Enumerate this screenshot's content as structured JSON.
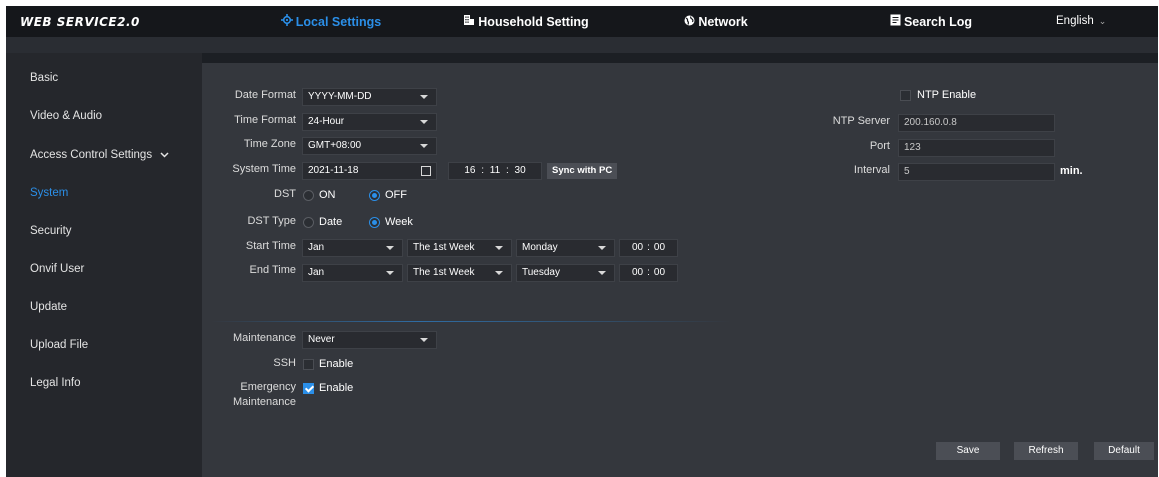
{
  "brand": "WEB SERVICE2.0",
  "nav": [
    {
      "label": "Local Settings",
      "icon": "gear-icon",
      "active": true
    },
    {
      "label": "Household Setting",
      "icon": "building-icon",
      "active": false
    },
    {
      "label": "Network",
      "icon": "globe-icon",
      "active": false
    },
    {
      "label": "Search Log",
      "icon": "document-icon",
      "active": false
    }
  ],
  "language": "English",
  "sidebar": {
    "items": [
      "Basic",
      "Video & Audio",
      "Access Control Settings",
      "System",
      "Security",
      "Onvif User",
      "Update",
      "Upload File",
      "Legal Info"
    ],
    "active": "System"
  },
  "form": {
    "date_format": {
      "label": "Date Format",
      "value": "YYYY-MM-DD"
    },
    "time_format": {
      "label": "Time Format",
      "value": "24-Hour"
    },
    "time_zone": {
      "label": "Time Zone",
      "value": "GMT+08:00"
    },
    "system_time": {
      "label": "System Time",
      "date": "2021-11-18",
      "hour": "16",
      "minute": "11",
      "second": "30",
      "sep": ":",
      "sync_label": "Sync with PC"
    },
    "dst": {
      "label": "DST",
      "on_label": "ON",
      "off_label": "OFF",
      "value": "OFF"
    },
    "dst_type": {
      "label": "DST Type",
      "date_label": "Date",
      "week_label": "Week",
      "value": "Week"
    },
    "start_time": {
      "label": "Start Time",
      "month": "Jan",
      "week": "The 1st Week",
      "day": "Monday",
      "hour": "00",
      "minute": "00"
    },
    "end_time": {
      "label": "End Time",
      "month": "Jan",
      "week": "The 1st Week",
      "day": "Tuesday",
      "hour": "00",
      "minute": "00"
    },
    "maintenance": {
      "label": "Maintenance",
      "value": "Never"
    },
    "ssh": {
      "label": "SSH",
      "enable_label": "Enable",
      "checked": false
    },
    "emergency": {
      "label_line1": "Emergency",
      "label_line2": "Maintenance",
      "enable_label": "Enable",
      "checked": true
    }
  },
  "ntp": {
    "enable_label": "NTP Enable",
    "enabled": false,
    "server_label": "NTP Server",
    "server_value": "200.160.0.8",
    "port_label": "Port",
    "port_value": "123",
    "interval_label": "Interval",
    "interval_value": "5",
    "interval_unit": "min."
  },
  "buttons": {
    "save": "Save",
    "refresh": "Refresh",
    "default": "Default"
  },
  "colors": {
    "accent": "#2b8fe8",
    "background": "#1c1f24",
    "panel": "#34373d"
  }
}
